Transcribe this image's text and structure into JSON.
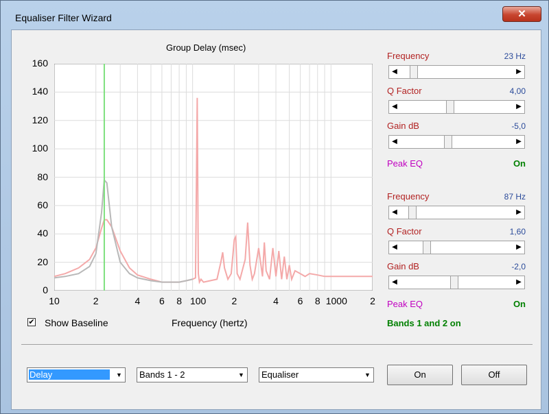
{
  "window": {
    "title": "Equaliser Filter Wizard",
    "close_glyph": "✕"
  },
  "chart": {
    "title": "Group Delay (msec)",
    "xlabel": "Frequency (hertz)",
    "y_ticks": [
      "160",
      "140",
      "120",
      "100",
      "80",
      "60",
      "40",
      "20",
      "0"
    ],
    "x_ticks": [
      "10",
      "2",
      "4",
      "6",
      "8",
      "100",
      "2",
      "4",
      "6",
      "8",
      "1000",
      "2"
    ]
  },
  "chart_data": {
    "type": "line",
    "title": "Group Delay (msec)",
    "xlabel": "Frequency (hertz)",
    "ylabel": "",
    "x_scale": "log",
    "xlim": [
      10,
      2000
    ],
    "ylim": [
      0,
      160
    ],
    "grid": true,
    "series": [
      {
        "color": "#f4a9a9",
        "x": [
          10,
          12,
          15,
          18,
          20,
          22,
          23,
          24,
          26,
          30,
          35,
          40,
          50,
          60,
          70,
          80,
          90,
          100,
          105,
          108,
          110,
          112,
          115,
          120,
          150,
          160,
          165,
          170,
          180,
          190,
          200,
          205,
          210,
          220,
          240,
          250,
          260,
          270,
          280,
          300,
          320,
          330,
          340,
          360,
          380,
          400,
          420,
          440,
          460,
          480,
          500,
          520,
          550,
          600,
          650,
          700,
          800,
          900,
          1000,
          1200,
          1500,
          2000
        ],
        "y": [
          10,
          12,
          16,
          22,
          30,
          44,
          50,
          50,
          45,
          28,
          16,
          11,
          8,
          6,
          6,
          6,
          7,
          8,
          9,
          136,
          12,
          6,
          8,
          6,
          8,
          20,
          27,
          16,
          8,
          12,
          36,
          38,
          12,
          8,
          22,
          48,
          18,
          8,
          12,
          30,
          10,
          34,
          14,
          8,
          30,
          10,
          28,
          8,
          24,
          8,
          18,
          8,
          14,
          12,
          10,
          12,
          11,
          10,
          10,
          10,
          10,
          10
        ]
      },
      {
        "color": "#b8b8b8",
        "x": [
          10,
          12,
          15,
          18,
          20,
          22,
          23,
          24,
          26,
          30,
          35,
          40,
          50,
          60,
          70,
          80,
          90,
          100
        ],
        "y": [
          9,
          10,
          12,
          17,
          26,
          55,
          78,
          76,
          45,
          20,
          12,
          9,
          7,
          6,
          6,
          6,
          7,
          8
        ]
      }
    ],
    "marker": {
      "x": 23,
      "color": "#7ee07e"
    }
  },
  "band1": {
    "frequency_label": "Frequency",
    "frequency_value": "23 Hz",
    "frequency_pos": 0.09,
    "q_label": "Q Factor",
    "q_value": "4,00",
    "q_pos": 0.43,
    "gain_label": "Gain  dB",
    "gain_value": "-5,0",
    "gain_pos": 0.41,
    "type_label": "Peak EQ",
    "state": "On"
  },
  "band2": {
    "frequency_label": "Frequency",
    "frequency_value": "87 Hz",
    "frequency_pos": 0.08,
    "q_label": "Q Factor",
    "q_value": "1,60",
    "q_pos": 0.21,
    "gain_label": "Gain  dB",
    "gain_value": "-2,0",
    "gain_pos": 0.47,
    "type_label": "Peak EQ",
    "state": "On"
  },
  "show_baseline": {
    "label": "Show Baseline",
    "checked": true
  },
  "bands_status": "Bands 1 and 2 on",
  "controls": {
    "view_select": "Delay",
    "bands_select": "Bands 1 - 2",
    "mode_select": "Equaliser",
    "on_button": "On",
    "off_button": "Off"
  },
  "colors": {
    "label_red": "#b22222",
    "value_blue": "#2a4a9a",
    "peak_magenta": "#c000c0",
    "green": "#008000"
  }
}
